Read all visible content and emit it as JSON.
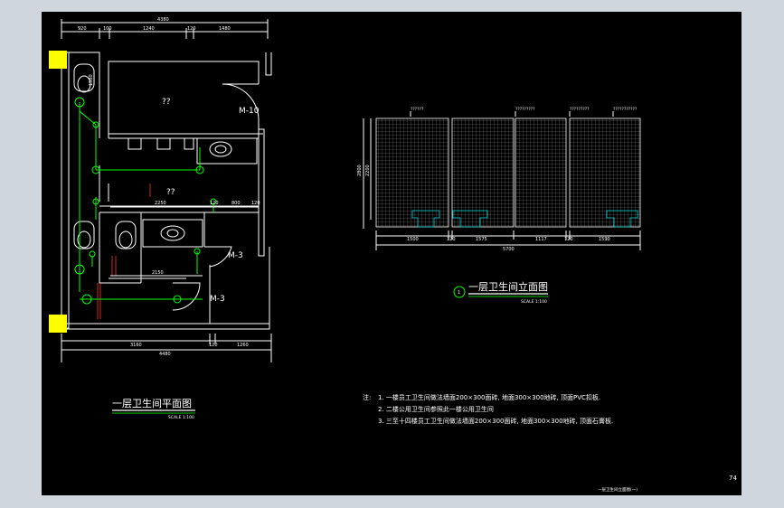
{
  "plan": {
    "top_dims": {
      "total": "4380",
      "d1": "920",
      "d2": "100",
      "d3": "1240",
      "d4": "120",
      "d5": "1480"
    },
    "bottom_dims": {
      "d1": "3160",
      "d2": "120",
      "d3": "1260",
      "total": "4480"
    },
    "left_dims": {
      "d1": "1580"
    },
    "inner_dims": {
      "a": "2250",
      "b": "120",
      "c": "800",
      "d": "120",
      "e": "2150"
    },
    "rooms": {
      "r1": "??",
      "r2": "??"
    },
    "doors": {
      "d1": "M-10",
      "d2": "M-3",
      "d3": "M-3"
    },
    "title": "一层卫生间平面图",
    "scale": "SCALE 1:100"
  },
  "elevation": {
    "height_dims": {
      "total": "2800",
      "inner": "2200"
    },
    "bottom_dims": {
      "d1": "1500",
      "d2": "120",
      "d3": "1575",
      "d4": "1117",
      "d5": "120",
      "d6": "1590"
    },
    "total_width": "5700",
    "top_labels": {
      "l1": "??????",
      "l2": "?????????",
      "l3": "?????????",
      "l4": "???????????"
    },
    "title": "一层卫生间立面图",
    "scale": "SCALE 1:100",
    "marker": "1"
  },
  "notes": {
    "label": "注:",
    "n1": "1. 一楼员工卫生间做法墙面200×300面砖, 地面300×300地砖, 顶面PVC扣板.",
    "n2": "2. 二楼公用卫生间参照此一楼公用卫生间",
    "n3": "3. 三至十四楼员工卫生间做法墙面200×300面砖, 地面300×300地砖, 顶面石膏板."
  },
  "page_number": "74",
  "footer_label": "一层卫生间立面图(一)",
  "colors": {
    "sheet": "#000000",
    "background": "#cfd6dd",
    "green": "#00ff00",
    "white": "#ffffff",
    "yellow": "#ffff00",
    "red": "#ff3030"
  }
}
